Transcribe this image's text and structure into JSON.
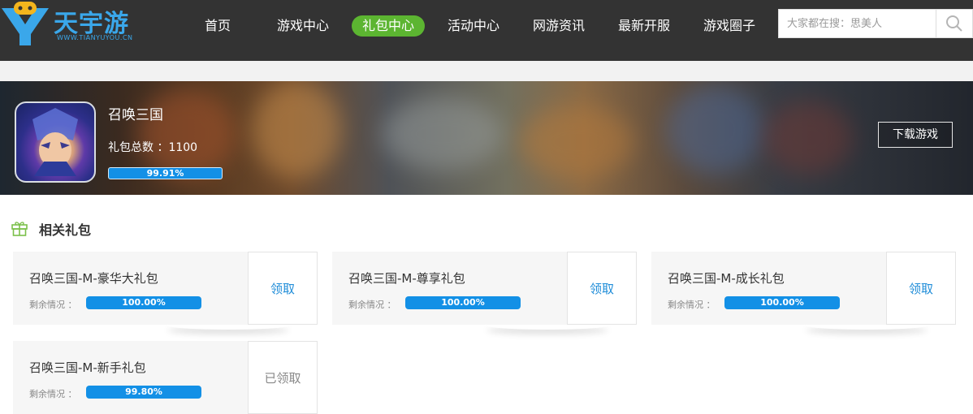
{
  "brand": {
    "name": "天宇游",
    "domain": "WWW.TIANYUYOU.CN",
    "color": "#3aa7ea"
  },
  "nav": {
    "items": [
      {
        "label": "首页",
        "active": false
      },
      {
        "label": "游戏中心",
        "active": false
      },
      {
        "label": "礼包中心",
        "active": true
      },
      {
        "label": "活动中心",
        "active": false
      },
      {
        "label": "网游资讯",
        "active": false
      },
      {
        "label": "最新开服",
        "active": false
      },
      {
        "label": "游戏圈子",
        "active": false
      }
    ],
    "active_color": "#5cb531"
  },
  "search": {
    "placeholder": "大家都在搜：思美人",
    "icon": "search-icon"
  },
  "game": {
    "title": "召唤三国",
    "gift_total_label": "礼包总数 ：1100",
    "remaining_percent": 99.91,
    "remaining_text": "99.91%",
    "download_label": "下载游戏"
  },
  "section": {
    "title": "相关礼包",
    "icon": "gift-icon"
  },
  "gifts": [
    {
      "name": "召唤三国-M-豪华大礼包",
      "remain_label": "剩余情况 ：",
      "percent": 100.0,
      "percent_text": "100.00%",
      "action": "领取",
      "claimed": false
    },
    {
      "name": "召唤三国-M-尊享礼包",
      "remain_label": "剩余情况 ：",
      "percent": 100.0,
      "percent_text": "100.00%",
      "action": "领取",
      "claimed": false
    },
    {
      "name": "召唤三国-M-成长礼包",
      "remain_label": "剩余情况 ：",
      "percent": 100.0,
      "percent_text": "100.00%",
      "action": "领取",
      "claimed": false
    },
    {
      "name": "召唤三国-M-新手礼包",
      "remain_label": "剩余情况 ：",
      "percent": 99.8,
      "percent_text": "99.80%",
      "action": "已领取",
      "claimed": true
    }
  ],
  "colors": {
    "header_bg": "#333333",
    "progress": "#1390e6",
    "claim_link": "#1e8cd8"
  }
}
